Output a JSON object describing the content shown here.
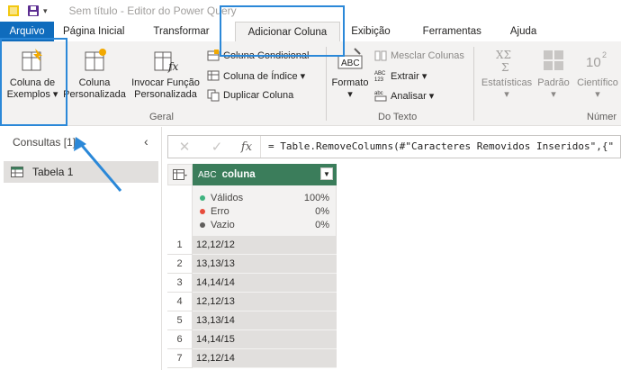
{
  "window": {
    "title": "Sem título - Editor do Power Query"
  },
  "tabs": [
    {
      "label": "Arquivo"
    },
    {
      "label": "Página Inicial"
    },
    {
      "label": "Transformar"
    },
    {
      "label": "Adicionar Coluna"
    },
    {
      "label": "Exibição"
    },
    {
      "label": "Ferramentas"
    },
    {
      "label": "Ajuda"
    }
  ],
  "ribbon": {
    "geral": {
      "label": "Geral",
      "coluna_exemplos_l1": "Coluna de",
      "coluna_exemplos_l2": "Exemplos",
      "coluna_personalizada_l1": "Coluna",
      "coluna_personalizada_l2": "Personalizada",
      "invocar_funcao_l1": "Invocar Função",
      "invocar_funcao_l2": "Personalizada",
      "coluna_condicional": "Coluna Condicional",
      "coluna_indice": "Coluna de Índice",
      "duplicar_coluna": "Duplicar Coluna"
    },
    "do_texto": {
      "label": "Do Texto",
      "formato": "Formato",
      "mesclar_colunas": "Mesclar Colunas",
      "extrair": "Extrair",
      "analisar": "Analisar"
    },
    "numero": {
      "label": "Númer",
      "estatisticas": "Estatísticas",
      "padrao": "Padrão",
      "cientifico": "Científico"
    }
  },
  "left_pane": {
    "title": "Consultas [1]",
    "items": [
      {
        "label": "Tabela 1"
      }
    ]
  },
  "formula_bar": {
    "formula": "= Table.RemoveColumns(#\"Caracteres Removidos Inseridos\",{\""
  },
  "grid": {
    "column": {
      "name": "coluna",
      "type_glyph": "ABC"
    },
    "quality": [
      {
        "label": "Válidos",
        "pct": "100%",
        "color": "#3fb37f"
      },
      {
        "label": "Erro",
        "pct": "0%",
        "color": "#e74c3c"
      },
      {
        "label": "Vazio",
        "pct": "0%",
        "color": "#605e5c"
      }
    ],
    "rows": [
      {
        "n": "1",
        "value": "12,12/12"
      },
      {
        "n": "2",
        "value": "13,13/13"
      },
      {
        "n": "3",
        "value": "14,14/14"
      },
      {
        "n": "4",
        "value": "12,12/13"
      },
      {
        "n": "5",
        "value": "13,13/14"
      },
      {
        "n": "6",
        "value": "14,14/15"
      },
      {
        "n": "7",
        "value": "12,12/14"
      }
    ]
  },
  "colors": {
    "accent": "#0f6cbd",
    "highlight": "#2b88d8",
    "column_header": "#3b7d5b"
  }
}
